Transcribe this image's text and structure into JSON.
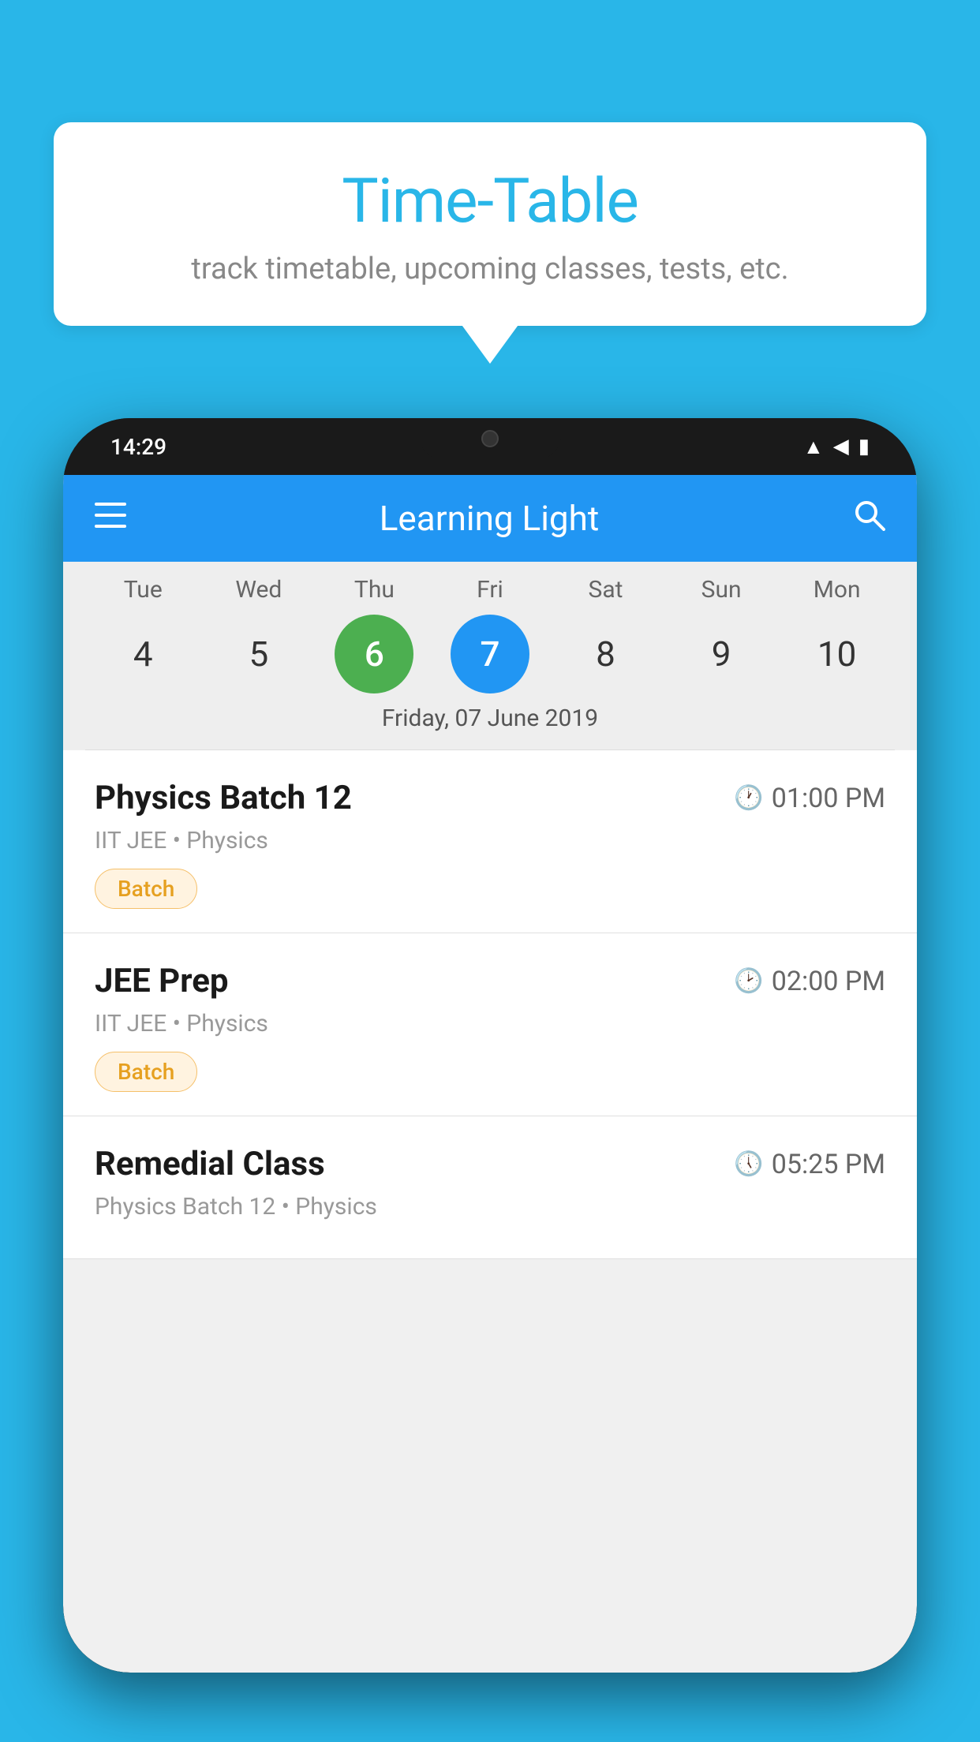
{
  "background_color": "#29b6e8",
  "bubble": {
    "title": "Time-Table",
    "subtitle": "track timetable, upcoming classes, tests, etc."
  },
  "phone": {
    "status_bar": {
      "time": "14:29"
    },
    "app_bar": {
      "title": "Learning Light",
      "menu_icon": "menu-icon",
      "search_icon": "search-icon"
    },
    "calendar": {
      "days": [
        "Tue",
        "Wed",
        "Thu",
        "Fri",
        "Sat",
        "Sun",
        "Mon"
      ],
      "dates": [
        "4",
        "5",
        "6",
        "7",
        "8",
        "9",
        "10"
      ],
      "today_index": 2,
      "selected_index": 3,
      "selected_date_label": "Friday, 07 June 2019"
    },
    "schedule": [
      {
        "title": "Physics Batch 12",
        "time": "01:00 PM",
        "subtitle": "IIT JEE • Physics",
        "badge": "Batch"
      },
      {
        "title": "JEE Prep",
        "time": "02:00 PM",
        "subtitle": "IIT JEE • Physics",
        "badge": "Batch"
      },
      {
        "title": "Remedial Class",
        "time": "05:25 PM",
        "subtitle": "Physics Batch 12 • Physics",
        "badge": null
      }
    ]
  }
}
